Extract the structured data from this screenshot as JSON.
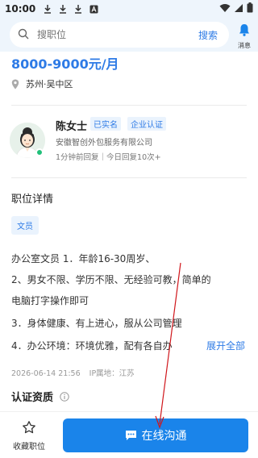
{
  "status_bar": {
    "time": "10:00"
  },
  "search": {
    "placeholder": "搜职位",
    "button_label": "搜索"
  },
  "messages": {
    "label": "消息"
  },
  "job": {
    "salary": "8000-9000元/月",
    "location": "苏州·吴中区"
  },
  "recruiter": {
    "name": "陈女士",
    "badge_verified": "已实名",
    "badge_company": "企业认证",
    "company": "安徽智创外包服务有限公司",
    "activity": "1分钟前回复｜今日回复10次+"
  },
  "details": {
    "title": "职位详情",
    "tag": "文员",
    "lines": [
      "办公室文员 1．年龄16-30周岁、",
      "2、男女不限、学历不限、无经验可教，简单的",
      "电脑打字操作即可",
      "3．身体健康、有上进心，服从公司管理",
      "4．办公环境：环境优雅，配有各自办"
    ],
    "expand_label": "展开全部",
    "date": "2026-06-14 21:56",
    "ip": "IP属地：江苏"
  },
  "certification": {
    "title": "认证资质"
  },
  "bottom": {
    "favorite_label": "收藏职位",
    "chat_label": "在线沟通"
  },
  "colors": {
    "accent": "#2e7be6",
    "button": "#1a84ea",
    "online": "#21c07a",
    "arrow": "#d0161b"
  },
  "icons": [
    "download-icon",
    "a-box-icon",
    "wifi-icon",
    "signal-icon",
    "battery-icon",
    "search-icon",
    "bell-icon",
    "location-pin-icon",
    "info-icon",
    "star-icon",
    "chat-bubble-icon"
  ]
}
